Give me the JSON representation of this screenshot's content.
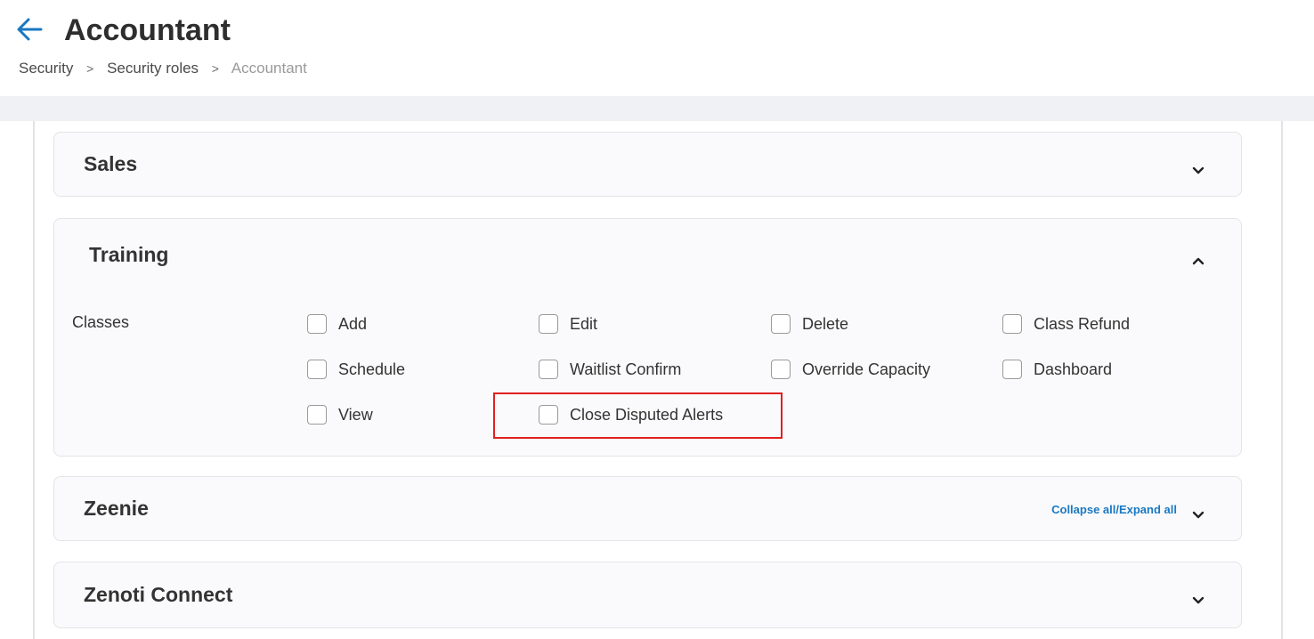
{
  "header": {
    "title": "Accountant",
    "back_icon": "arrow-left-icon",
    "accent_color": "#1a78c2"
  },
  "breadcrumb": {
    "items": [
      "Security",
      "Security roles",
      "Accountant"
    ],
    "separator": ">"
  },
  "panels": {
    "sales": {
      "title": "Sales",
      "state": "collapsed",
      "chevron_icon": "chevron-down-icon"
    },
    "training": {
      "title": "Training",
      "state": "expanded",
      "chevron_icon": "chevron-up-icon",
      "section_label": "Classes",
      "permissions": [
        {
          "label": "Add",
          "checked": false
        },
        {
          "label": "Edit",
          "checked": false
        },
        {
          "label": "Delete",
          "checked": false
        },
        {
          "label": "Class Refund",
          "checked": false
        },
        {
          "label": "Schedule",
          "checked": false
        },
        {
          "label": "Waitlist Confirm",
          "checked": false
        },
        {
          "label": "Override Capacity",
          "checked": false
        },
        {
          "label": "Dashboard",
          "checked": false
        },
        {
          "label": "View",
          "checked": false
        },
        {
          "label": "Close Disputed Alerts",
          "checked": false,
          "highlighted": true
        }
      ]
    },
    "zeenie": {
      "title": "Zeenie",
      "state": "collapsed",
      "chevron_icon": "chevron-down-icon",
      "toggle_all_label": "Collapse all/Expand all"
    },
    "zenoti_connect": {
      "title": "Zenoti Connect",
      "state": "collapsed",
      "chevron_icon": "chevron-down-icon"
    }
  },
  "highlight_color": "#e02020"
}
